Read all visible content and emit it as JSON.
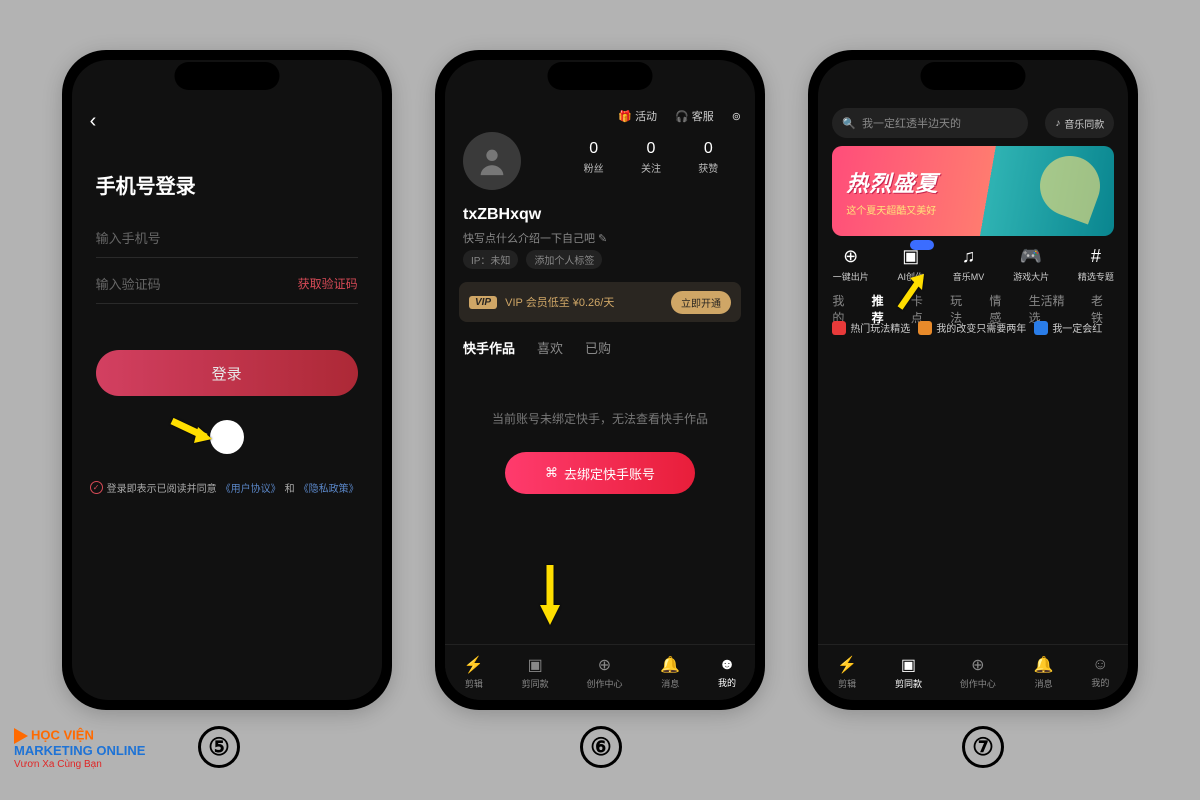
{
  "steps": [
    "⑤",
    "⑥",
    "⑦"
  ],
  "logo": {
    "line1": "HỌC VIỆN",
    "line2": "MARKETING ONLINE",
    "line3": "Vươn Xa Cùng Bạn"
  },
  "phone1": {
    "title": "手机号登录",
    "phone_placeholder": "输入手机号",
    "code_placeholder": "输入验证码",
    "get_code": "获取验证码",
    "login": "登录",
    "terms_prefix": "登录即表示已阅读并同意",
    "terms_link1": "《用户协议》",
    "terms_mid": "和",
    "terms_link2": "《隐私政策》"
  },
  "phone2": {
    "top_activity": "活动",
    "top_support": "客服",
    "stats": [
      {
        "n": "0",
        "l": "粉丝"
      },
      {
        "n": "0",
        "l": "关注"
      },
      {
        "n": "0",
        "l": "获赞"
      }
    ],
    "username": "txZBHxqw",
    "desc": "快写点什么介绍一下自己吧",
    "ip": "IP：未知",
    "add_tag": "添加个人标签",
    "vip_badge": "VIP",
    "vip_text": "VIP 会员低至 ¥0.26/天",
    "vip_cta": "立即开通",
    "tabs": [
      "快手作品",
      "喜欢",
      "已购"
    ],
    "empty": "当前账号未绑定快手，无法查看快手作品",
    "bind": "去绑定快手账号",
    "nav": [
      "剪辑",
      "剪同款",
      "创作中心",
      "消息",
      "我的"
    ]
  },
  "phone3": {
    "search": "我一定红透半边天的",
    "music": "音乐同款",
    "banner_title": "热烈盛夏",
    "banner_sub": "这个夏天超酷又美好",
    "shortcuts": [
      {
        "ic": "⊕",
        "l": "一键出片"
      },
      {
        "ic": "▣",
        "l": "AI创作"
      },
      {
        "ic": "♫",
        "l": "音乐MV"
      },
      {
        "ic": "🎮",
        "l": "游戏大片"
      },
      {
        "ic": "#",
        "l": "精选专题"
      }
    ],
    "filters": [
      "我的",
      "推荐",
      "卡点",
      "玩法",
      "情感",
      "生活精选",
      "老铁"
    ],
    "chips": [
      {
        "color": "red",
        "l": "热门玩法精选"
      },
      {
        "color": "orange",
        "l": "我的改变只需要两年"
      },
      {
        "color": "blue",
        "l": "我一定会红"
      }
    ],
    "nav": [
      "剪辑",
      "剪同款",
      "创作中心",
      "消息",
      "我的"
    ]
  }
}
